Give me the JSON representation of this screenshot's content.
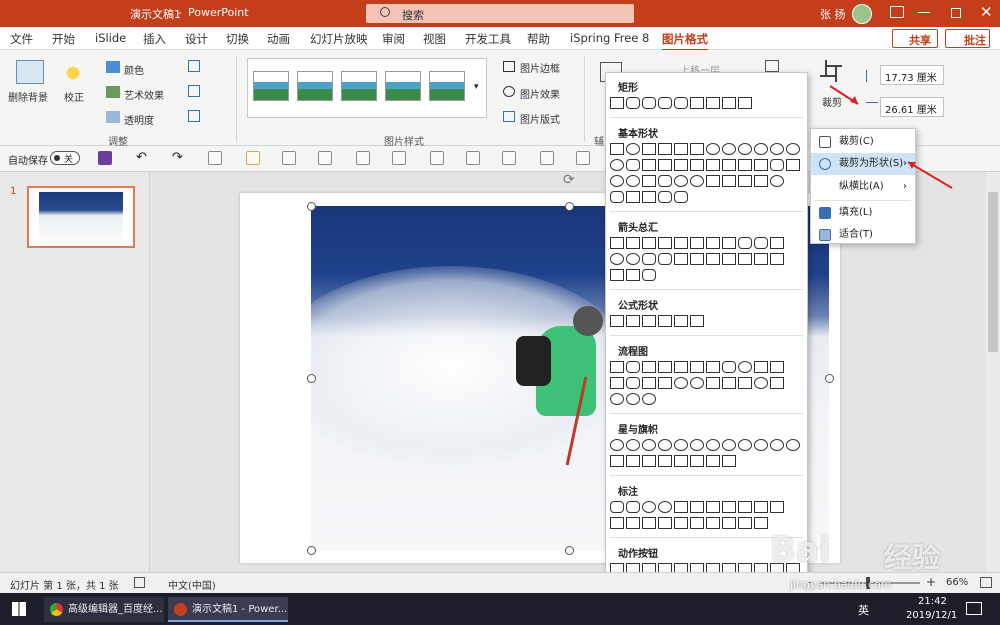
{
  "titlebar": {
    "doc_title": "演示文稿1",
    "separator": "-",
    "app_name": "PowerPoint",
    "search_placeholder": "搜索",
    "user_name": "张 扬",
    "window_controls": [
      "minimize-icon",
      "restore-icon",
      "close-icon"
    ]
  },
  "ribbon_tabs": [
    "文件",
    "开始",
    "iSlide",
    "插入",
    "设计",
    "切换",
    "动画",
    "幻灯片放映",
    "审阅",
    "视图",
    "开发工具",
    "帮助",
    "iSpring Free 8",
    "图片格式"
  ],
  "active_tab": "图片格式",
  "share_label": "共享",
  "comment_label": "批注",
  "ribbon": {
    "remove_bg": "删除背景",
    "correct": "校正",
    "color": "颜色",
    "artistic": "艺术效果",
    "transparency": "透明度",
    "group_adjust": "调整",
    "group_picstyle": "图片样式",
    "group_aux": "辅",
    "border": "图片边框",
    "effects": "图片效果",
    "layout": "图片版式",
    "bring_forward": "上移一层",
    "crop": "裁剪",
    "height_value": "17.73 厘米",
    "width_value": "26.61 厘米"
  },
  "qat": {
    "autosave_label": "自动保存",
    "autosave_state": "关"
  },
  "slide_panel": {
    "slide_number": "1"
  },
  "shapes_gallery": {
    "sections": [
      "矩形",
      "基本形状",
      "箭头总汇",
      "公式形状",
      "流程图",
      "星与旗帜",
      "标注",
      "动作按钮"
    ]
  },
  "crop_menu": {
    "items": [
      "裁剪(C)",
      "裁剪为形状(S)",
      "纵横比(A)",
      "填充(L)",
      "适合(T)"
    ]
  },
  "statusbar": {
    "slide_info": "幻灯片 第 1 张，共 1 张",
    "language": "中文(中国)",
    "zoom_minus": "-",
    "zoom_plus": "+",
    "zoom": "66%"
  },
  "taskbar": {
    "app1": "高级编辑器_百度经...",
    "app2": "演示文稿1 - Power...",
    "ime": "英",
    "time": "21:42",
    "date": "2019/12/1"
  },
  "watermark": {
    "brand": "Bai",
    "brand2": "经验",
    "url": "jingyan.baidu.com"
  },
  "colors": {
    "accent": "#c43e1c",
    "menu_highlight": "#cfe3f7",
    "taskbar": "#1d1e2a"
  }
}
